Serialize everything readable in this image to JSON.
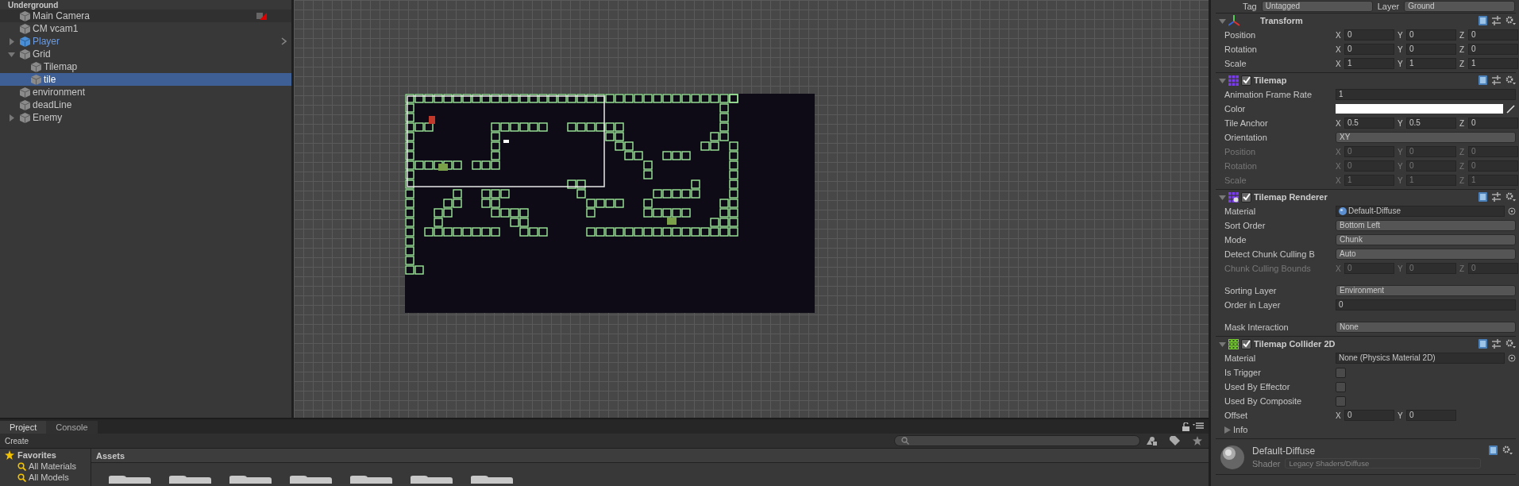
{
  "hierarchy": {
    "scene": "Underground",
    "items": [
      {
        "name": "Main Camera",
        "selected": false,
        "prefab": false,
        "warning": true
      },
      {
        "name": "CM vcam1",
        "selected": false,
        "prefab": false,
        "warning": false
      },
      {
        "name": "Player",
        "selected": false,
        "prefab": true,
        "warning": false,
        "expanded": false
      },
      {
        "name": "Grid",
        "selected": false,
        "prefab": false,
        "warning": false,
        "expanded": true,
        "children": [
          {
            "name": "Tilemap",
            "selected": false,
            "prefab": false,
            "warning": false
          },
          {
            "name": "tile",
            "selected": true,
            "prefab": false,
            "warning": false
          }
        ]
      },
      {
        "name": "environment",
        "selected": false,
        "prefab": false,
        "warning": false
      },
      {
        "name": "deadLine",
        "selected": false,
        "prefab": false,
        "warning": false
      },
      {
        "name": "Enemy",
        "selected": false,
        "prefab": false,
        "warning": false,
        "expanded": false
      }
    ]
  },
  "bottom": {
    "tabs": [
      {
        "label": "Project",
        "selected": true
      },
      {
        "label": "Console",
        "selected": false
      }
    ],
    "create": "Create",
    "favorites": "Favorites",
    "favorite_items": [
      "All Materials",
      "All Models"
    ],
    "breadcrumb": "Assets"
  },
  "inspector": {
    "tag_label": "Tag",
    "tag": "Untagged",
    "layer_label": "Layer",
    "layer": "Ground",
    "components": [
      {
        "kind": "transform",
        "title": "Transform",
        "fields": [
          {
            "kind": "vector",
            "label": "Position",
            "disabled": false,
            "values": [
              {
                "axis": "X",
                "value": "0"
              },
              {
                "axis": "Y",
                "value": "0"
              },
              {
                "axis": "Z",
                "value": "0"
              }
            ]
          },
          {
            "kind": "vector",
            "label": "Rotation",
            "disabled": false,
            "values": [
              {
                "axis": "X",
                "value": "0"
              },
              {
                "axis": "Y",
                "value": "0"
              },
              {
                "axis": "Z",
                "value": "0"
              }
            ]
          },
          {
            "kind": "vector",
            "label": "Scale",
            "disabled": false,
            "values": [
              {
                "axis": "X",
                "value": "1"
              },
              {
                "axis": "Y",
                "value": "1"
              },
              {
                "axis": "Z",
                "value": "1"
              }
            ]
          }
        ]
      },
      {
        "kind": "tilemap",
        "title": "Tilemap",
        "enabled": true,
        "fields": [
          {
            "kind": "text",
            "label": "Animation Frame Rate",
            "disabled": false,
            "value": "1"
          },
          {
            "kind": "color",
            "label": "Color",
            "disabled": false,
            "color": "#ffffff"
          },
          {
            "kind": "vector",
            "label": "Tile Anchor",
            "disabled": false,
            "values": [
              {
                "axis": "X",
                "value": "0.5"
              },
              {
                "axis": "Y",
                "value": "0.5"
              },
              {
                "axis": "Z",
                "value": "0"
              }
            ]
          },
          {
            "kind": "dropdown",
            "label": "Orientation",
            "disabled": false,
            "value": "XY"
          },
          {
            "kind": "vector",
            "label": "Position",
            "disabled": true,
            "values": [
              {
                "axis": "X",
                "value": "0"
              },
              {
                "axis": "Y",
                "value": "0"
              },
              {
                "axis": "Z",
                "value": "0"
              }
            ]
          },
          {
            "kind": "vector",
            "label": "Rotation",
            "disabled": true,
            "values": [
              {
                "axis": "X",
                "value": "0"
              },
              {
                "axis": "Y",
                "value": "0"
              },
              {
                "axis": "Z",
                "value": "0"
              }
            ]
          },
          {
            "kind": "vector",
            "label": "Scale",
            "disabled": true,
            "values": [
              {
                "axis": "X",
                "value": "1"
              },
              {
                "axis": "Y",
                "value": "1"
              },
              {
                "axis": "Z",
                "value": "1"
              }
            ]
          }
        ]
      },
      {
        "kind": "renderer",
        "title": "Tilemap Renderer",
        "enabled": true,
        "fields": [
          {
            "kind": "object",
            "label": "Material",
            "disabled": false,
            "value": "Default-Diffuse",
            "sphere": true
          },
          {
            "kind": "dropdown",
            "label": "Sort Order",
            "disabled": false,
            "value": "Bottom Left"
          },
          {
            "kind": "dropdown",
            "label": "Mode",
            "disabled": false,
            "value": "Chunk"
          },
          {
            "kind": "dropdown",
            "label": "Detect Chunk Culling B",
            "disabled": false,
            "value": "Auto"
          },
          {
            "kind": "vector",
            "label": "Chunk Culling Bounds",
            "disabled": true,
            "values": [
              {
                "axis": "X",
                "value": "0"
              },
              {
                "axis": "Y",
                "value": "0"
              },
              {
                "axis": "Z",
                "value": "0"
              }
            ]
          },
          {
            "kind": "dropdown",
            "label": "Sorting Layer",
            "disabled": false,
            "value": "Environment",
            "gap_before": true
          },
          {
            "kind": "text",
            "label": "Order in Layer",
            "disabled": false,
            "value": "0"
          },
          {
            "kind": "dropdown",
            "label": "Mask Interaction",
            "disabled": false,
            "value": "None",
            "gap_before": true
          }
        ]
      },
      {
        "kind": "collider",
        "title": "Tilemap Collider 2D",
        "enabled": true,
        "fields": [
          {
            "kind": "object",
            "label": "Material",
            "disabled": false,
            "value": "None (Physics Material 2D)",
            "sphere": false
          },
          {
            "kind": "checkbox",
            "label": "Is Trigger",
            "disabled": false,
            "checked": false
          },
          {
            "kind": "checkbox",
            "label": "Used By Effector",
            "disabled": false,
            "checked": false
          },
          {
            "kind": "checkbox",
            "label": "Used By Composite",
            "disabled": false,
            "checked": false
          },
          {
            "kind": "vector",
            "label": "Offset",
            "disabled": false,
            "values": [
              {
                "axis": "X",
                "value": "0"
              },
              {
                "axis": "Y",
                "value": "0"
              }
            ]
          },
          {
            "kind": "foldout",
            "label": "Info",
            "disabled": false
          }
        ]
      }
    ],
    "material": {
      "name": "Default-Diffuse",
      "shader_label": "Shader",
      "shader": "Legacy Shaders/Diffuse"
    }
  }
}
